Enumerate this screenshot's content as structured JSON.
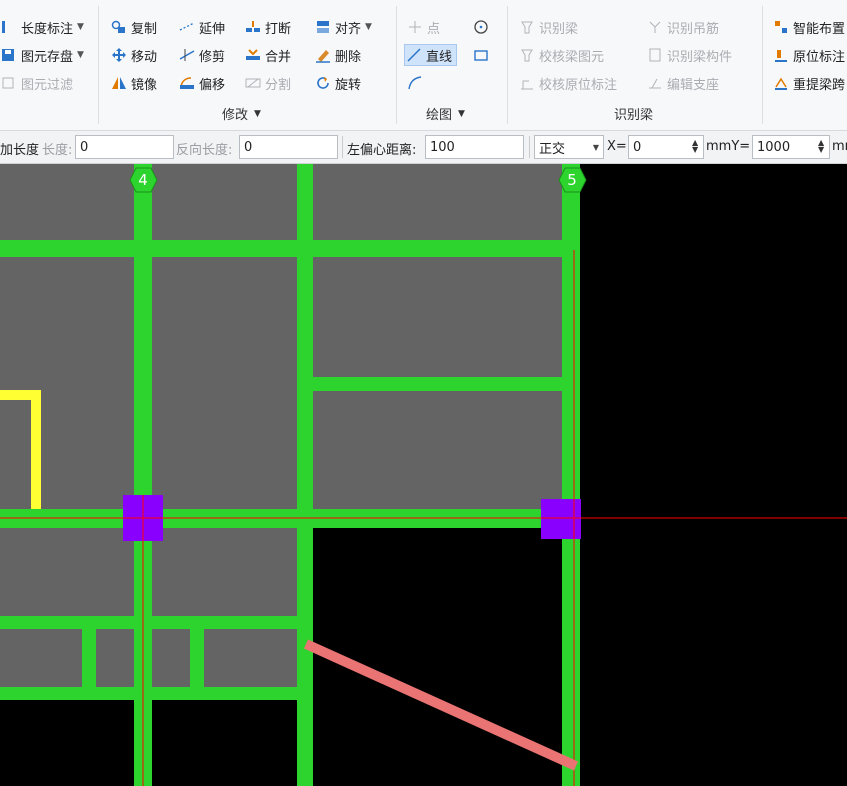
{
  "ribbon": {
    "col1": {
      "length_mark": "长度标注",
      "element_save": "图元存盘",
      "element_filter": "图元过滤"
    },
    "modify": {
      "copy": "复制",
      "extend": "延伸",
      "break": "打断",
      "align": "对齐",
      "move": "移动",
      "trim": "修剪",
      "merge": "合并",
      "delete": "删除",
      "mirror": "镜像",
      "offset": "偏移",
      "split": "分割",
      "rotate": "旋转",
      "group_label": "修改"
    },
    "draw": {
      "point": "点",
      "line": "直线",
      "group_label": "绘图"
    },
    "identify_beam": {
      "identify_beam": "识别梁",
      "identify_hanger": "识别吊筋",
      "check_beam_elements": "校核梁图元",
      "identify_beam_members": "识别梁构件",
      "check_original_marks": "校核原位标注",
      "edit_support": "编辑支座",
      "group_label": "识别梁"
    },
    "col5": {
      "smart_layout": "智能布置",
      "original_mark": "原位标注",
      "re_extract_span": "重提梁跨"
    }
  },
  "toolbar": {
    "add_length_label": "加长度",
    "length_label": "长度:",
    "length_value": "0",
    "reverse_length_label": "反向长度:",
    "reverse_length_value": "0",
    "left_offset_label": "左偏心距离:",
    "left_offset_value": "100",
    "mode_value": "正交",
    "x_label": "X=",
    "x_value": "0",
    "mm_y_label": "mmY=",
    "y_value": "1000",
    "mm_tail": "mm"
  },
  "canvas": {
    "axis_labels": [
      "4",
      "5"
    ],
    "colors": {
      "background": "#000000",
      "slab": "#646464",
      "beam": "#2ed42e",
      "column": "#8a00ff",
      "wall": "#ffff33",
      "crosshair": "#ff0000",
      "drawn_line": "#ea7373"
    }
  }
}
